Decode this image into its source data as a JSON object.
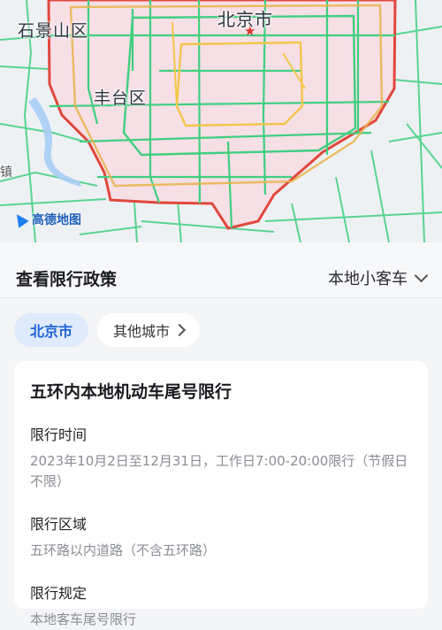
{
  "map": {
    "labels": {
      "shijingshan": "石景山区",
      "beijing": "北京市",
      "fengtai": "丰台区",
      "edge_char": "镇"
    },
    "logo_text": "高德地图",
    "colors": {
      "zone_fill": "#f7dfe6",
      "zone_border": "#e0483c",
      "road_green": "#3fcf7e",
      "road_yellow": "#f3c64a",
      "water": "#a7cdf5"
    }
  },
  "sheet": {
    "title": "查看限行政策",
    "vehicle_type": "本地小客车",
    "city_tabs": [
      {
        "label": "北京市",
        "active": true
      },
      {
        "label": "其他城市",
        "active": false
      }
    ],
    "policy": {
      "title": "五环内本地机动车尾号限行",
      "sections": [
        {
          "label": "限行时间",
          "value": "2023年10月2日至12月31日，工作日7:00-20:00限行（节假日不限）"
        },
        {
          "label": "限行区域",
          "value": "五环路以内道路（不含五环路）"
        },
        {
          "label": "限行规定",
          "value": "本地客车尾号限行"
        }
      ]
    },
    "colors": {
      "accent": "#1f63d6",
      "active_tab_bg": "#dfeafc"
    }
  }
}
